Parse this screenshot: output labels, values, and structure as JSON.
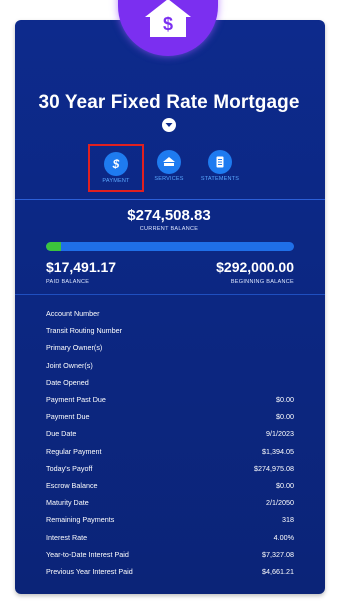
{
  "account": {
    "title": "30 Year Fixed Rate Mortgage",
    "actions": [
      {
        "label": "PAYMENT",
        "icon": "dollar-icon"
      },
      {
        "label": "SERVICES",
        "icon": "bank-icon"
      },
      {
        "label": "STATEMENTS",
        "icon": "document-icon"
      }
    ],
    "current_balance": "$274,508.83",
    "current_balance_label": "CURRENT BALANCE",
    "paid_balance": "$17,491.17",
    "paid_balance_label": "PAID BALANCE",
    "beginning_balance": "$292,000.00",
    "beginning_balance_label": "BEGINNING BALANCE",
    "paid_fraction": 0.06
  },
  "details": [
    {
      "label": "Account Number",
      "value": ""
    },
    {
      "label": "Transit Routing Number",
      "value": ""
    },
    {
      "label": "Primary Owner(s)",
      "value": ""
    },
    {
      "label": "Joint Owner(s)",
      "value": ""
    },
    {
      "label": "Date Opened",
      "value": ""
    },
    {
      "label": "Payment Past Due",
      "value": "$0.00"
    },
    {
      "label": "Payment Due",
      "value": "$0.00"
    },
    {
      "label": "Due Date",
      "value": "9/1/2023"
    },
    {
      "label": "Regular Payment",
      "value": "$1,394.05"
    },
    {
      "label": "Today's Payoff",
      "value": "$274,975.08"
    },
    {
      "label": "Escrow Balance",
      "value": "$0.00"
    },
    {
      "label": "Maturity Date",
      "value": "2/1/2050"
    },
    {
      "label": "Remaining Payments",
      "value": "318"
    },
    {
      "label": "Interest Rate",
      "value": "4.00%"
    },
    {
      "label": "Year-to-Date Interest Paid",
      "value": "$7,327.08"
    },
    {
      "label": "Previous Year Interest Paid",
      "value": "$4,661.21"
    }
  ],
  "colors": {
    "card": "#0d2a8c",
    "badge": "#7b2ff0",
    "action": "#1e7bf0",
    "progress_track": "#1f6fe8",
    "progress_fill": "#3cc43c",
    "highlight": "#e02020"
  }
}
